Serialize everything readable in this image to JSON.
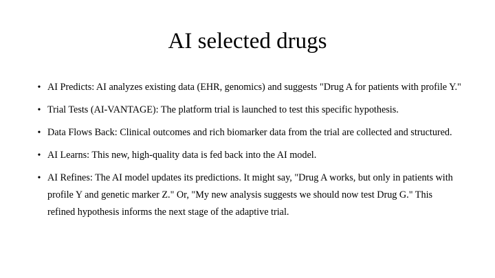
{
  "slide": {
    "title": "AI selected drugs",
    "bullet_glyph": "•",
    "bullets": [
      "AI Predicts: AI analyzes existing data (EHR, genomics) and suggests \"Drug A for patients with profile Y.\"",
      "Trial Tests (AI-VANTAGE): The platform trial is launched to test this specific hypothesis.",
      "Data Flows Back: Clinical outcomes and rich biomarker data from the trial are collected and structured.",
      "AI Learns: This new, high-quality data is fed back into the AI model.",
      "AI Refines: The AI model updates its predictions. It might say, \"Drug A works, but only in patients with profile Y and genetic marker Z.\" Or, \"My new analysis suggests we should now test Drug G.\" This refined hypothesis informs the next stage of the adaptive trial."
    ]
  }
}
